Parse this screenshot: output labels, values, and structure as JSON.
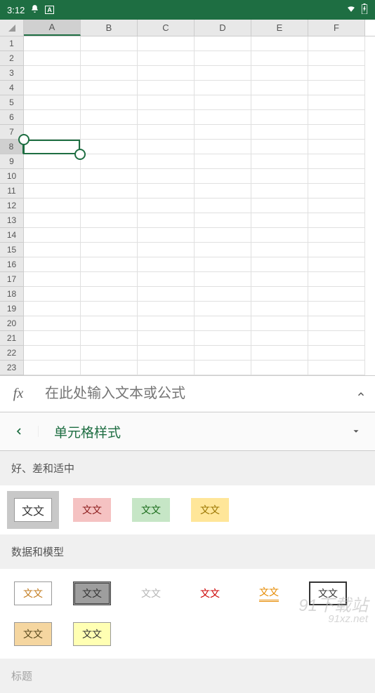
{
  "status": {
    "time": "3:12"
  },
  "columns": [
    "A",
    "B",
    "C",
    "D",
    "E",
    "F"
  ],
  "rows": [
    1,
    2,
    3,
    4,
    5,
    6,
    7,
    8,
    9,
    10,
    11,
    12,
    13,
    14,
    15,
    16,
    17,
    18,
    19,
    20,
    21,
    22,
    23
  ],
  "selection": {
    "col": "A",
    "row": 8
  },
  "formula_bar": {
    "fx": "fx",
    "placeholder": "在此处输入文本或公式"
  },
  "ribbon": {
    "title": "单元格样式"
  },
  "sections": {
    "neutral": {
      "title": "好、差和适中",
      "swatches": [
        {
          "label": "文文",
          "bg": "#ffffff",
          "border": "1px solid #999",
          "color": "#333",
          "selected": true
        },
        {
          "label": "文文",
          "bg": "#f5c2c2",
          "color": "#8b1a1a"
        },
        {
          "label": "文文",
          "bg": "#c6e6c6",
          "color": "#1a6b1a"
        },
        {
          "label": "文文",
          "bg": "#ffe699",
          "color": "#9a7500"
        }
      ]
    },
    "data": {
      "title": "数据和模型",
      "swatches": [
        {
          "label": "文文",
          "bg": "#ffffff",
          "border": "1px solid #999",
          "color": "#c27b1e"
        },
        {
          "label": "文文",
          "bg": "#9e9e9e",
          "border": "3px double #444",
          "color": "#333"
        },
        {
          "label": "文文",
          "bg": "#ffffff",
          "color": "#b5b5b5"
        },
        {
          "label": "文文",
          "bg": "#ffffff",
          "color": "#cc0000"
        },
        {
          "label": "文文",
          "bg": "#ffffff",
          "color": "#e68a00",
          "underline": "double"
        },
        {
          "label": "文文",
          "bg": "#ffffff",
          "border": "2px solid #333",
          "color": "#333"
        },
        {
          "label": "文文",
          "bg": "#f5d6a0",
          "border": "1px solid #999",
          "color": "#5a4a1e"
        },
        {
          "label": "文文",
          "bg": "#ffffb3",
          "border": "1px solid #999",
          "color": "#333"
        }
      ]
    },
    "title_section": {
      "title": "标题"
    }
  },
  "watermark": {
    "line1": "91下载站",
    "line2": "91xz.net"
  }
}
